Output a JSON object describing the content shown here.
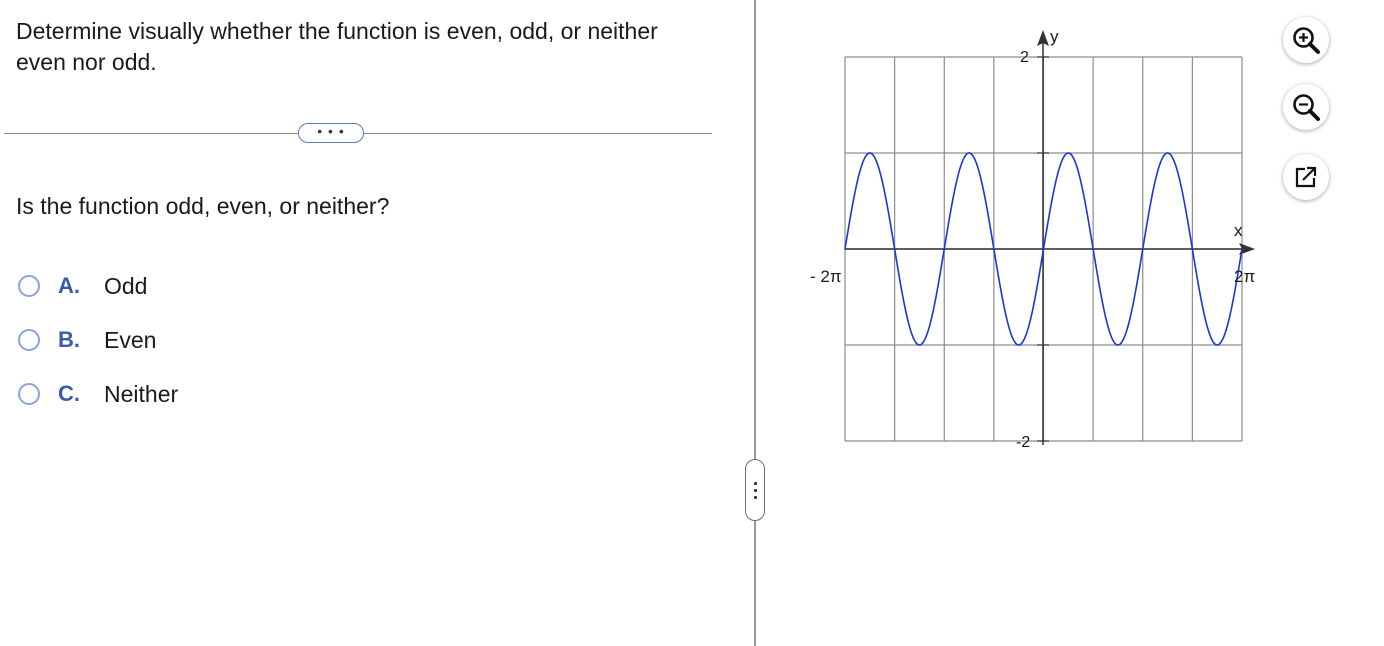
{
  "question": {
    "text": "Determine visually whether the function is even, odd, or neither even nor odd."
  },
  "more_button": {
    "label": "• • •"
  },
  "prompt": "Is the function odd, even, or neither?",
  "choices": [
    {
      "letter": "A.",
      "text": "Odd"
    },
    {
      "letter": "B.",
      "text": "Even"
    },
    {
      "letter": "C.",
      "text": "Neither"
    }
  ],
  "graph": {
    "x_axis_label": "x",
    "y_axis_label": "y",
    "x_tick_left": "- 2π",
    "x_tick_right": "2π",
    "y_tick_top": "2",
    "y_tick_bottom": "-2",
    "curve_color": "#1a37d6"
  },
  "chart_data": {
    "type": "line",
    "title": "",
    "xlabel": "x",
    "ylabel": "y",
    "xlim": [
      -6.2832,
      6.2832
    ],
    "ylim": [
      -2,
      2
    ],
    "grid": true,
    "series": [
      {
        "function": "y = sin(2x)",
        "x_range": [
          -6.2832,
          6.2832
        ]
      }
    ]
  },
  "tools": {
    "zoom_in": "zoom-in-icon",
    "zoom_out": "zoom-out-icon",
    "popout": "external-link-icon"
  }
}
